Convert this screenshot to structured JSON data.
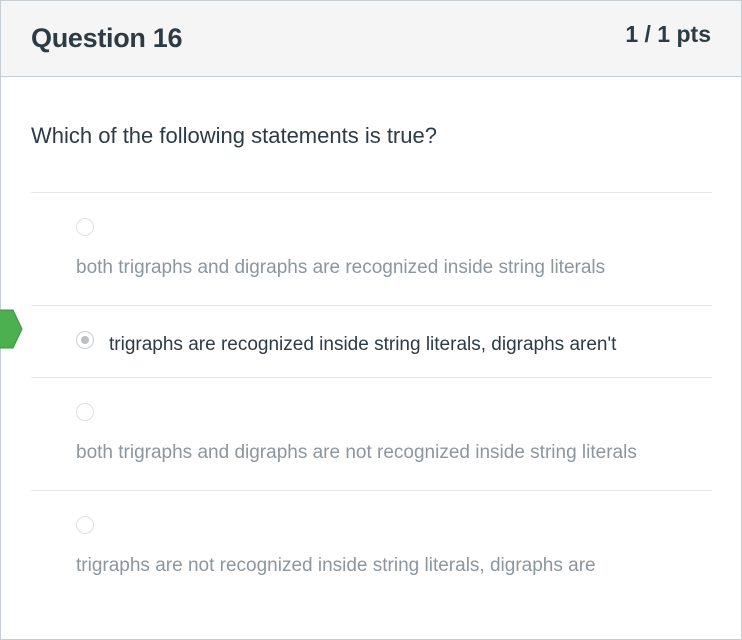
{
  "question": {
    "title": "Question 16",
    "points": "1 / 1 pts",
    "text": "Which of the following statements is true?"
  },
  "answers": [
    {
      "label": "both trigraphs and digraphs are recognized inside string literals",
      "selected": false
    },
    {
      "label": "trigraphs are recognized inside string literals, digraphs aren't",
      "selected": true
    },
    {
      "label": "both trigraphs and digraphs are not recognized inside string literals",
      "selected": false
    },
    {
      "label": "trigraphs are not recognized inside string literals, digraphs are",
      "selected": false
    }
  ],
  "colors": {
    "correct_marker": "#4caf50",
    "text": "#2d3b45",
    "muted_text": "#8b969e",
    "header_bg": "#f5f5f5"
  },
  "icons": {
    "correct_marker": "correct-answer-arrow-icon"
  }
}
